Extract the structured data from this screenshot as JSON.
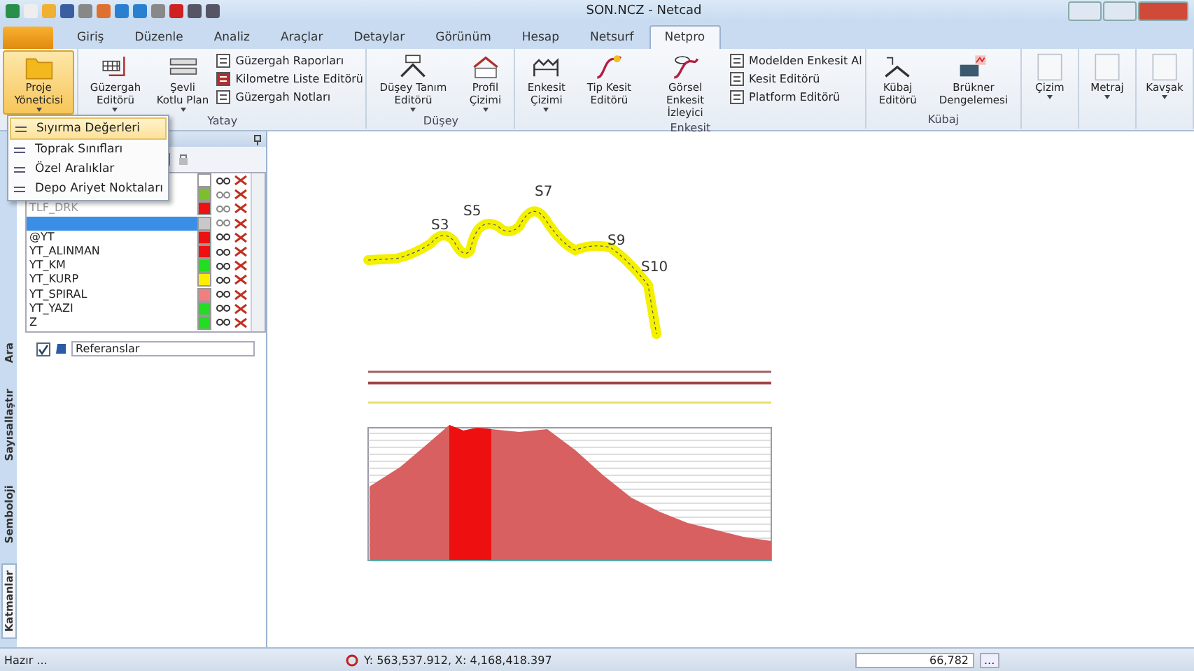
{
  "window": {
    "title": "SON.NCZ - Netcad"
  },
  "tabs": [
    {
      "label": "Giriş",
      "selected": false
    },
    {
      "label": "Düzenle",
      "selected": false
    },
    {
      "label": "Analiz",
      "selected": false
    },
    {
      "label": "Araçlar",
      "selected": false
    },
    {
      "label": "Detaylar",
      "selected": false
    },
    {
      "label": "Görünüm",
      "selected": false
    },
    {
      "label": "Hesap",
      "selected": false
    },
    {
      "label": "Netsurf",
      "selected": false
    },
    {
      "label": "Netpro",
      "selected": true
    }
  ],
  "ribbon_groups": [
    {
      "large": [
        {
          "label": "Proje Yöneticisi",
          "has_menu": true,
          "pressed": true
        }
      ]
    },
    {
      "label": "Yatay",
      "large": [
        {
          "label": "Güzergah Editörü",
          "has_menu": true,
          "pressed": false
        },
        {
          "label": "Şevli Kotlu Plan",
          "has_menu": true,
          "pressed": false
        }
      ],
      "small": [
        "Güzergah Raporları",
        "Kilometre Liste Editörü",
        "Güzergah Notları"
      ]
    },
    {
      "label": "Düşey",
      "large": [
        {
          "label": "Düşey Tanım Editörü",
          "has_menu": true,
          "pressed": false
        },
        {
          "label": "Profil Çizimi",
          "has_menu": true,
          "pressed": false
        }
      ]
    },
    {
      "label": "Enkesit",
      "large": [
        {
          "label": "Enkesit Çizimi",
          "has_menu": true,
          "pressed": false
        },
        {
          "label": "Tip Kesit Editörü",
          "has_menu": false,
          "pressed": false
        },
        {
          "label": "Görsel Enkesit İzleyici",
          "has_menu": false,
          "pressed": false
        }
      ],
      "small": [
        "Modelden Enkesit Al",
        "Kesit Editörü",
        "Platform Editörü"
      ]
    },
    {
      "label": "Kübaj",
      "large": [
        {
          "label": "Kübaj Editörü",
          "has_menu": false,
          "pressed": false
        },
        {
          "label": "Brükner Dengelemesi",
          "has_menu": false,
          "pressed": false
        }
      ]
    },
    {
      "large": [
        {
          "label": "Çizim",
          "has_menu": true,
          "pressed": false
        }
      ]
    },
    {
      "large": [
        {
          "label": "Metraj",
          "has_menu": true,
          "pressed": false
        }
      ]
    },
    {
      "large": [
        {
          "label": "Kavşak",
          "has_menu": true,
          "pressed": false
        }
      ]
    }
  ],
  "dropdown_menu": [
    {
      "label": "Sıyırma Değerleri",
      "selected": true
    },
    {
      "label": "Toprak Sınıfları",
      "selected": false
    },
    {
      "label": "Özel Aralıklar",
      "selected": false
    },
    {
      "label": "Depo Ariyet Noktaları",
      "selected": false
    }
  ],
  "side_tabs": [
    {
      "label": "Ara",
      "selected": false
    },
    {
      "label": "Sayısallaştır",
      "selected": false
    },
    {
      "label": "Semboloji",
      "selected": false
    },
    {
      "label": "Katmanlar",
      "selected": true
    }
  ],
  "layers": [
    {
      "color": "#ffffff",
      "selected": false,
      "dimmed": false
    },
    {
      "color": "#7cbf2a",
      "selected": false,
      "dimmed": true
    },
    {
      "name": "TLF_DRK",
      "color": "#ee1111",
      "selected": false,
      "dimmed": true
    },
    {
      "color": "#c8c8c8",
      "selected": true,
      "dimmed": true
    },
    {
      "name": "@YT",
      "color": "#ee1111",
      "selected": false,
      "dimmed": false
    },
    {
      "name": "YT_ALINMAN",
      "color": "#ee1111",
      "selected": false,
      "dimmed": false
    },
    {
      "name": "YT_KM",
      "color": "#22dd22",
      "selected": false,
      "dimmed": false
    },
    {
      "name": "YT_KURP",
      "color": "#ffee00",
      "selected": false,
      "dimmed": false
    },
    {
      "name": "YT_SPIRAL",
      "color": "#f08080",
      "selected": false,
      "dimmed": false
    },
    {
      "name": "YT_YAZI",
      "color": "#22dd22",
      "selected": false,
      "dimmed": false
    },
    {
      "name": "Z",
      "color": "#22dd22",
      "selected": false,
      "dimmed": false
    }
  ],
  "references": {
    "label": "Referanslar",
    "checked": true
  },
  "drawing": {
    "stations": [
      "S3",
      "S5",
      "S7",
      "S9",
      "S10"
    ]
  },
  "status_bar": {
    "state": "Hazır ...",
    "coordinates": "Y: 563,537.912, X: 4,168,418.397",
    "scale": "66,782",
    "scale_button": "..."
  }
}
